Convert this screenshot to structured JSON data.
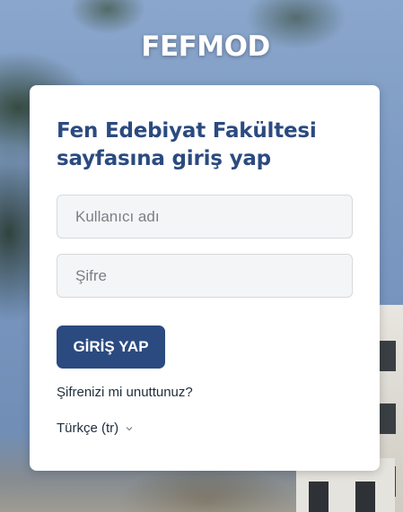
{
  "site": {
    "title": "FEFMOD"
  },
  "login": {
    "heading": "Fen Edebiyat Fakültesi sayfasına giriş yap",
    "username_placeholder": "Kullanıcı adı",
    "username_value": "",
    "password_placeholder": "Şifre",
    "password_value": "",
    "submit_label": "GİRİŞ YAP",
    "forgot_label": "Şifrenizi mi unuttunuz?",
    "language_label": "Türkçe (tr)"
  },
  "icons": {
    "language_dropdown": "chevron-down-icon"
  },
  "colors": {
    "brand": "#2b4a80",
    "card": "#ffffff",
    "field_bg": "#f4f5f7"
  }
}
